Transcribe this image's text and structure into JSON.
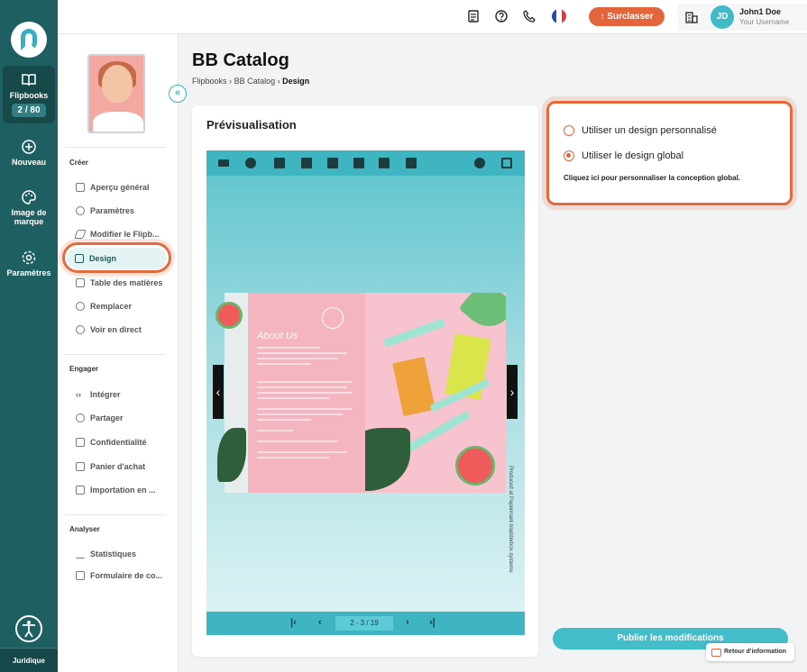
{
  "rail": {
    "flipbooks_label": "Flipbooks",
    "flipbooks_count": "2 / 80",
    "nouveau_label": "Nouveau",
    "brand_label": "Image de marque",
    "params_label": "Paramètres",
    "legal_label": "Juridique"
  },
  "topbar": {
    "upgrade_label": "Surclasser",
    "user_initials": "JD",
    "user_name": "John1 Doe",
    "user_sub": "Your Username"
  },
  "header": {
    "title": "BB Catalog",
    "crumb_1": "Flipbooks",
    "crumb_2": "BB Catalog",
    "crumb_3": "Design",
    "sep": "›"
  },
  "subnav": {
    "collapse_glyph": "«",
    "section_create": "Créer",
    "section_engage": "Engager",
    "section_analyze": "Analyser",
    "items": [
      {
        "label": "Aperçu général"
      },
      {
        "label": "Paramètres"
      },
      {
        "label": "Modifier le Flipb..."
      },
      {
        "label": "Design"
      },
      {
        "label": "Table des matières"
      },
      {
        "label": "Remplacer"
      },
      {
        "label": "Voir en direct"
      },
      {
        "label": "Intégrer"
      },
      {
        "label": "Partager"
      },
      {
        "label": "Confidentialité"
      },
      {
        "label": "Panier d'achat"
      },
      {
        "label": "Importation en ..."
      },
      {
        "label": "Statistiques"
      },
      {
        "label": "Formulaire de co..."
      }
    ]
  },
  "preview": {
    "title": "Prévisualisation",
    "page_indicator": "2 - 3 / 19",
    "book_heading": "About Us",
    "vertical_note": "Produced at Papermark bladderbox systeme",
    "prev_arrow": "‹",
    "next_arrow": "›",
    "first": "|‹",
    "prev": "‹",
    "next": "›",
    "last": "›|"
  },
  "design_options": {
    "option_custom": "Utiliser un design personnalisé",
    "option_global": "Utiliser le design global",
    "selected": "option_global",
    "hint": "Cliquez ici pour personnaliser la conception global."
  },
  "actions": {
    "publish_label": "Publier les modifications",
    "feedback_label": "Retour d'information"
  },
  "colors": {
    "rail": "#1e5f62",
    "accent": "#42bdc9",
    "highlight": "#e46a3e"
  }
}
